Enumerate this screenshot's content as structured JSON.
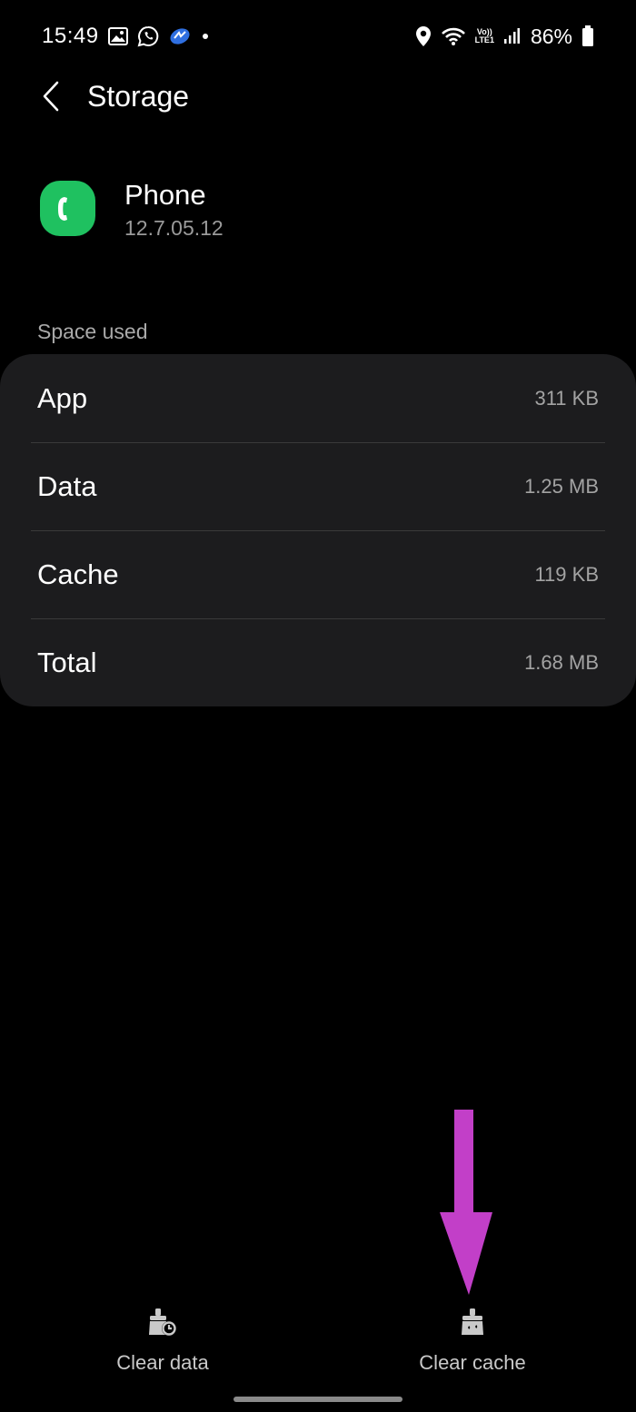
{
  "status_bar": {
    "time": "15:49",
    "volte_top": "Vo))",
    "volte_bottom": "LTE1",
    "battery": "86%"
  },
  "header": {
    "title": "Storage"
  },
  "app": {
    "name": "Phone",
    "version": "12.7.05.12",
    "icon": "phone-app-icon",
    "icon_color": "#1fc160"
  },
  "space_used": {
    "label": "Space used",
    "rows": [
      {
        "label": "App",
        "value": "311 KB"
      },
      {
        "label": "Data",
        "value": "1.25 MB"
      },
      {
        "label": "Cache",
        "value": "119 KB"
      },
      {
        "label": "Total",
        "value": "1.68 MB"
      }
    ]
  },
  "actions": {
    "clear_data": "Clear data",
    "clear_cache": "Clear cache"
  },
  "colors": {
    "background": "#000000",
    "card": "#1c1c1e",
    "annotation_arrow": "#c23fc8"
  }
}
